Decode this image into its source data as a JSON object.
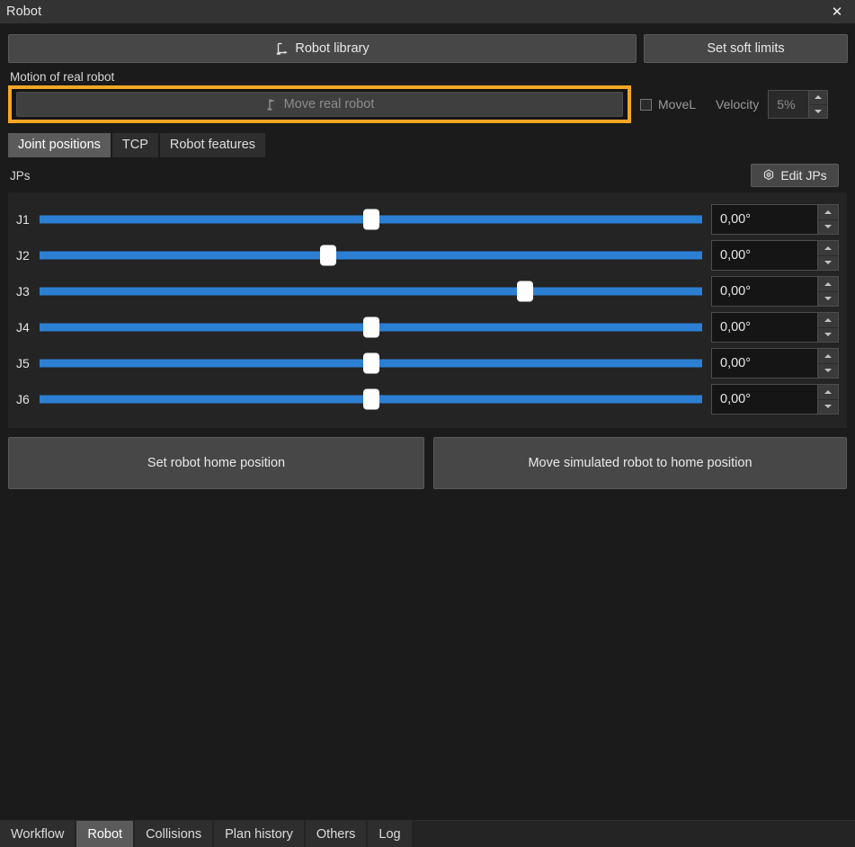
{
  "window": {
    "title": "Robot",
    "close_icon": "close-icon"
  },
  "toolbar": {
    "robot_library_label": "Robot library",
    "robot_library_icon": "robot-arm-icon",
    "set_soft_limits_label": "Set soft limits"
  },
  "motion": {
    "group_label": "Motion of real robot",
    "move_real_robot_label": "Move real robot",
    "move_real_robot_icon": "robot-arm-icon",
    "movel_label": "MoveL",
    "movel_checked": false,
    "velocity_label": "Velocity",
    "velocity_value": "5%"
  },
  "tabs": [
    {
      "label": "Joint positions",
      "active": true
    },
    {
      "label": "TCP",
      "active": false
    },
    {
      "label": "Robot features",
      "active": false
    }
  ],
  "jps": {
    "section_label": "JPs",
    "edit_button_label": "Edit JPs",
    "edit_button_icon": "gear-icon",
    "joints": [
      {
        "name": "J1",
        "value": "0,00°",
        "handle_percent": 50.0
      },
      {
        "name": "J2",
        "value": "0,00°",
        "handle_percent": 43.6
      },
      {
        "name": "J3",
        "value": "0,00°",
        "handle_percent": 73.3
      },
      {
        "name": "J4",
        "value": "0,00°",
        "handle_percent": 50.0
      },
      {
        "name": "J5",
        "value": "0,00°",
        "handle_percent": 50.0
      },
      {
        "name": "J6",
        "value": "0,00°",
        "handle_percent": 50.0
      }
    ]
  },
  "actions": {
    "set_home_label": "Set robot home position",
    "move_home_label": "Move simulated robot to home position"
  },
  "bottom_tabs": [
    {
      "label": "Workflow",
      "active": false
    },
    {
      "label": "Robot",
      "active": true
    },
    {
      "label": "Collisions",
      "active": false
    },
    {
      "label": "Plan history",
      "active": false
    },
    {
      "label": "Others",
      "active": false
    },
    {
      "label": "Log",
      "active": false
    }
  ],
  "colors": {
    "highlight": "#f5a623",
    "slider": "#2d7fd3",
    "panel_bg": "#1b1b1b",
    "titlebar_bg": "#333333"
  }
}
